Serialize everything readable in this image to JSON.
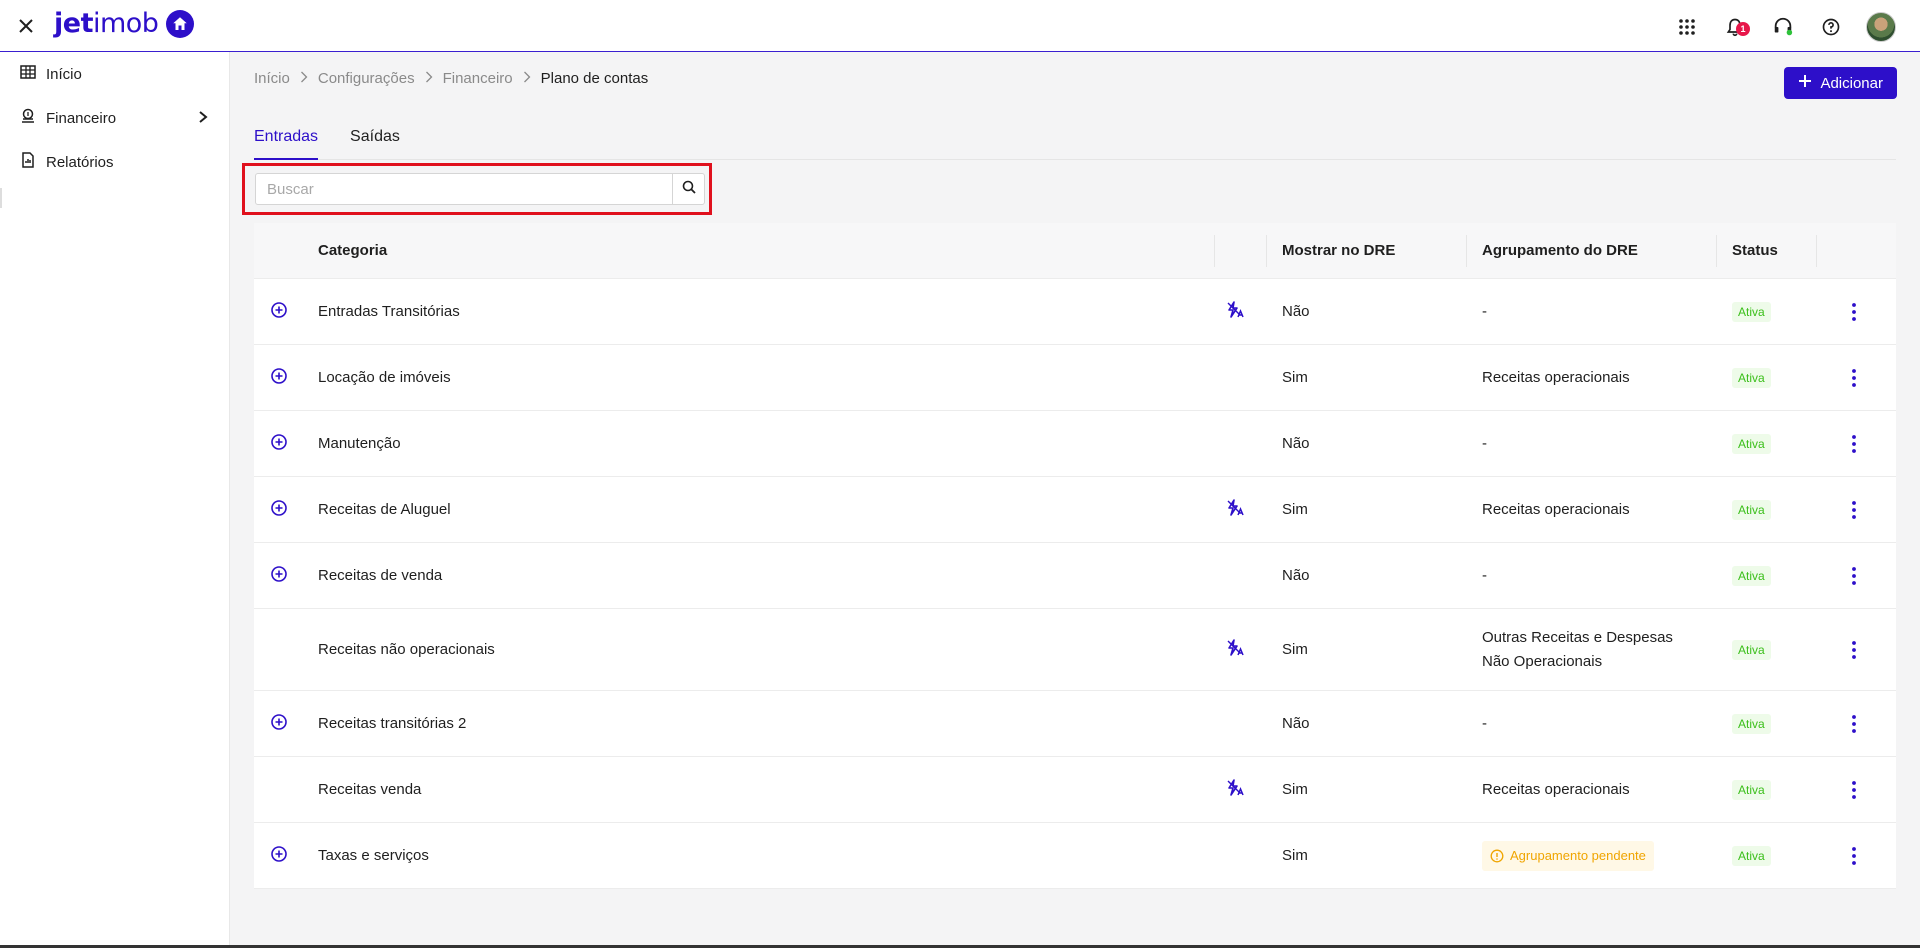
{
  "app": {
    "logo_text_bold": "jet",
    "logo_text_light": "imob",
    "notification_count": "1"
  },
  "colors": {
    "brand": "#2d0fc9",
    "status_active": "#3bbf1a",
    "pending": "#f0a500"
  },
  "sidebar": {
    "items": [
      {
        "label": "Início",
        "icon": "grid-icon"
      },
      {
        "label": "Financeiro",
        "icon": "money-icon"
      },
      {
        "label": "Relatórios",
        "icon": "report-icon"
      }
    ]
  },
  "breadcrumb": {
    "items": [
      "Início",
      "Configurações",
      "Financeiro"
    ],
    "current": "Plano de contas"
  },
  "header": {
    "add_label": "Adicionar"
  },
  "tabs": [
    {
      "label": "Entradas",
      "active": true
    },
    {
      "label": "Saídas",
      "active": false
    }
  ],
  "search": {
    "placeholder": "Buscar",
    "value": ""
  },
  "table": {
    "columns": {
      "category": "Categoria",
      "show_dre": "Mostrar no DRE",
      "dre_group": "Agrupamento do DRE",
      "status": "Status"
    },
    "rows": [
      {
        "category": "Entradas Transitórias",
        "auto": true,
        "show_dre": "Não",
        "group": "-",
        "status": "Ativa",
        "expandable": true
      },
      {
        "category": "Locação de imóveis",
        "auto": false,
        "show_dre": "Sim",
        "group": "Receitas operacionais",
        "status": "Ativa",
        "expandable": true
      },
      {
        "category": "Manutenção",
        "auto": false,
        "show_dre": "Não",
        "group": "-",
        "status": "Ativa",
        "expandable": true
      },
      {
        "category": "Receitas de Aluguel",
        "auto": true,
        "show_dre": "Sim",
        "group": "Receitas operacionais",
        "status": "Ativa",
        "expandable": true
      },
      {
        "category": "Receitas de venda",
        "auto": false,
        "show_dre": "Não",
        "group": "-",
        "status": "Ativa",
        "expandable": true
      },
      {
        "category": "Receitas não operacionais",
        "auto": true,
        "show_dre": "Sim",
        "group": "Outras Receitas e Despesas Não Operacionais",
        "status": "Ativa",
        "expandable": false
      },
      {
        "category": "Receitas transitórias 2",
        "auto": false,
        "show_dre": "Não",
        "group": "-",
        "status": "Ativa",
        "expandable": true
      },
      {
        "category": "Receitas venda",
        "auto": true,
        "show_dre": "Sim",
        "group": "Receitas operacionais",
        "status": "Ativa",
        "expandable": false
      },
      {
        "category": "Taxas e serviços",
        "auto": false,
        "show_dre": "Sim",
        "group": "Agrupamento pendente",
        "group_pending": true,
        "status": "Ativa",
        "expandable": true
      }
    ]
  }
}
